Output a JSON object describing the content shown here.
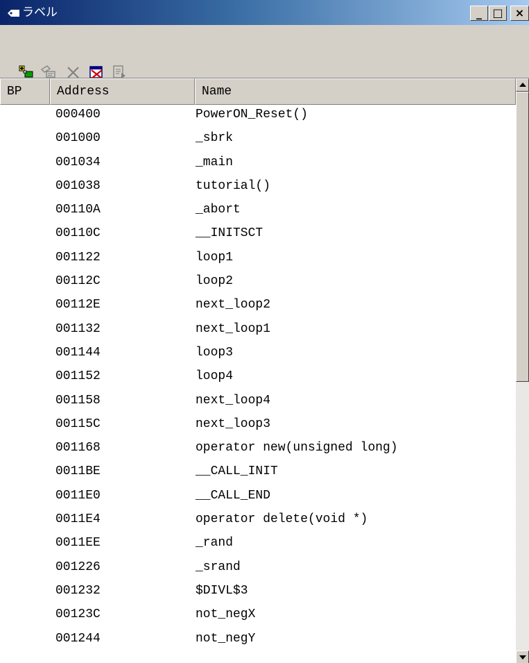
{
  "window": {
    "title": "ラベル",
    "minimize_glyph": "_",
    "maximize_glyph": "□",
    "close_glyph": "×"
  },
  "toolbar": {
    "buttons": [
      {
        "name": "add-label-button",
        "icon": "add-label-icon"
      },
      {
        "name": "edit-label-button",
        "icon": "edit-label-icon"
      },
      {
        "name": "delete-label-button",
        "icon": "delete-icon"
      },
      {
        "name": "delete-all-labels-button",
        "icon": "delete-all-icon"
      },
      {
        "name": "properties-button",
        "icon": "document-icon"
      }
    ]
  },
  "table": {
    "columns": [
      "BP",
      "Address",
      "Name"
    ],
    "rows": [
      {
        "address": "000400",
        "name": "PowerON_Reset()"
      },
      {
        "address": "001000",
        "name": "_sbrk"
      },
      {
        "address": "001034",
        "name": "_main"
      },
      {
        "address": "001038",
        "name": "tutorial()"
      },
      {
        "address": "00110A",
        "name": "_abort"
      },
      {
        "address": "00110C",
        "name": "__INITSCT"
      },
      {
        "address": "001122",
        "name": "loop1"
      },
      {
        "address": "00112C",
        "name": "loop2"
      },
      {
        "address": "00112E",
        "name": "next_loop2"
      },
      {
        "address": "001132",
        "name": "next_loop1"
      },
      {
        "address": "001144",
        "name": "loop3"
      },
      {
        "address": "001152",
        "name": "loop4"
      },
      {
        "address": "001158",
        "name": "next_loop4"
      },
      {
        "address": "00115C",
        "name": "next_loop3"
      },
      {
        "address": "001168",
        "name": "operator new(unsigned long)"
      },
      {
        "address": "0011BE",
        "name": "__CALL_INIT"
      },
      {
        "address": "0011E0",
        "name": "__CALL_END"
      },
      {
        "address": "0011E4",
        "name": "operator delete(void *)"
      },
      {
        "address": "0011EE",
        "name": "_rand"
      },
      {
        "address": "001226",
        "name": "_srand"
      },
      {
        "address": "001232",
        "name": "$DIVL$3"
      },
      {
        "address": "00123C",
        "name": "not_negX"
      },
      {
        "address": "001244",
        "name": "not_negY"
      }
    ]
  },
  "colors": {
    "title_start": "#0a246a",
    "title_end": "#a6caf0",
    "face": "#d4d0c8"
  }
}
